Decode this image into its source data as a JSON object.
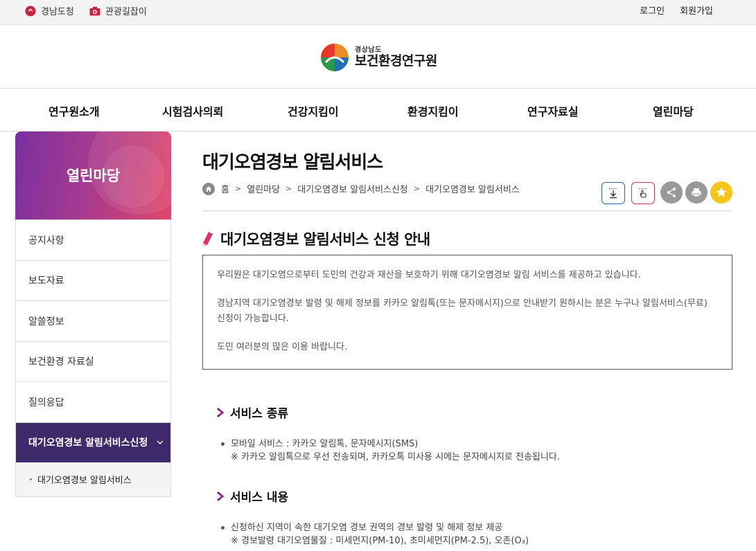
{
  "topbar": {
    "links": [
      {
        "label": "경남도청",
        "icon": "gyeongnam-emblem-icon"
      },
      {
        "label": "관광길잡이",
        "icon": "camera-icon"
      }
    ],
    "login": "로그인",
    "signup": "회원가입"
  },
  "logo": {
    "region": "경상남도",
    "name": "보건환경연구원"
  },
  "gnb": [
    "연구원소개",
    "시험검사의뢰",
    "건강지킴이",
    "환경지킴이",
    "연구자료실",
    "열린마당"
  ],
  "sidebar": {
    "title": "열린마당",
    "items": [
      "공지사항",
      "보도자료",
      "알쓸정보",
      "보건환경 자료실",
      "질의응답"
    ],
    "active": "대기오염경보 알림서비스신청",
    "sub": "대기오염경보 알림서비스"
  },
  "content": {
    "title": "대기오염경보 알림서비스",
    "breadcrumb": [
      "홈",
      "열린마당",
      "대기오염경보 알림서비스신청",
      "대기오염경보 알림서비스"
    ],
    "section_title": "대기오염경보 알림서비스 신청 안내",
    "notice": [
      "우리원은 대기오염으로부터 도민의 건강과 재산을 보호하기 위해 대기오염경보 알림 서비스를 제공하고 있습니다.",
      "경남지역 대기오염경보 발령 및 해제 정보를 카카오 알림톡(또는 문자메시지)으로 안내받기 원하시는 분은 누구나 알림서비스(무료) 신청이 가능합니다.",
      "도민 여러분의 많은 이용 바랍니다."
    ],
    "service_type": {
      "title": "서비스 종류",
      "line1": "모바일 서비스 : 카카오 알림톡, 문자메시지(SMS)",
      "line2": "※ 카카오 알림톡으로 우선 전송되며, 카카오톡 미사용 시에는 문자메시지로 전송됩니다."
    },
    "service_content": {
      "title": "서비스 내용",
      "line1": "신청하신 지역이 속한 대기오염 경보 권역의 경보 발령 및 해제 정보 제공",
      "line2": "※ 경보발령 대기오염물질 : 미세먼지(PM-10), 초미세먼지(PM-2.5), 오존(O₃)"
    }
  },
  "colors": {
    "sidebar_active": "#3e2a6b",
    "accent_magenta": "#d6246e",
    "favorite": "#f5c518"
  }
}
